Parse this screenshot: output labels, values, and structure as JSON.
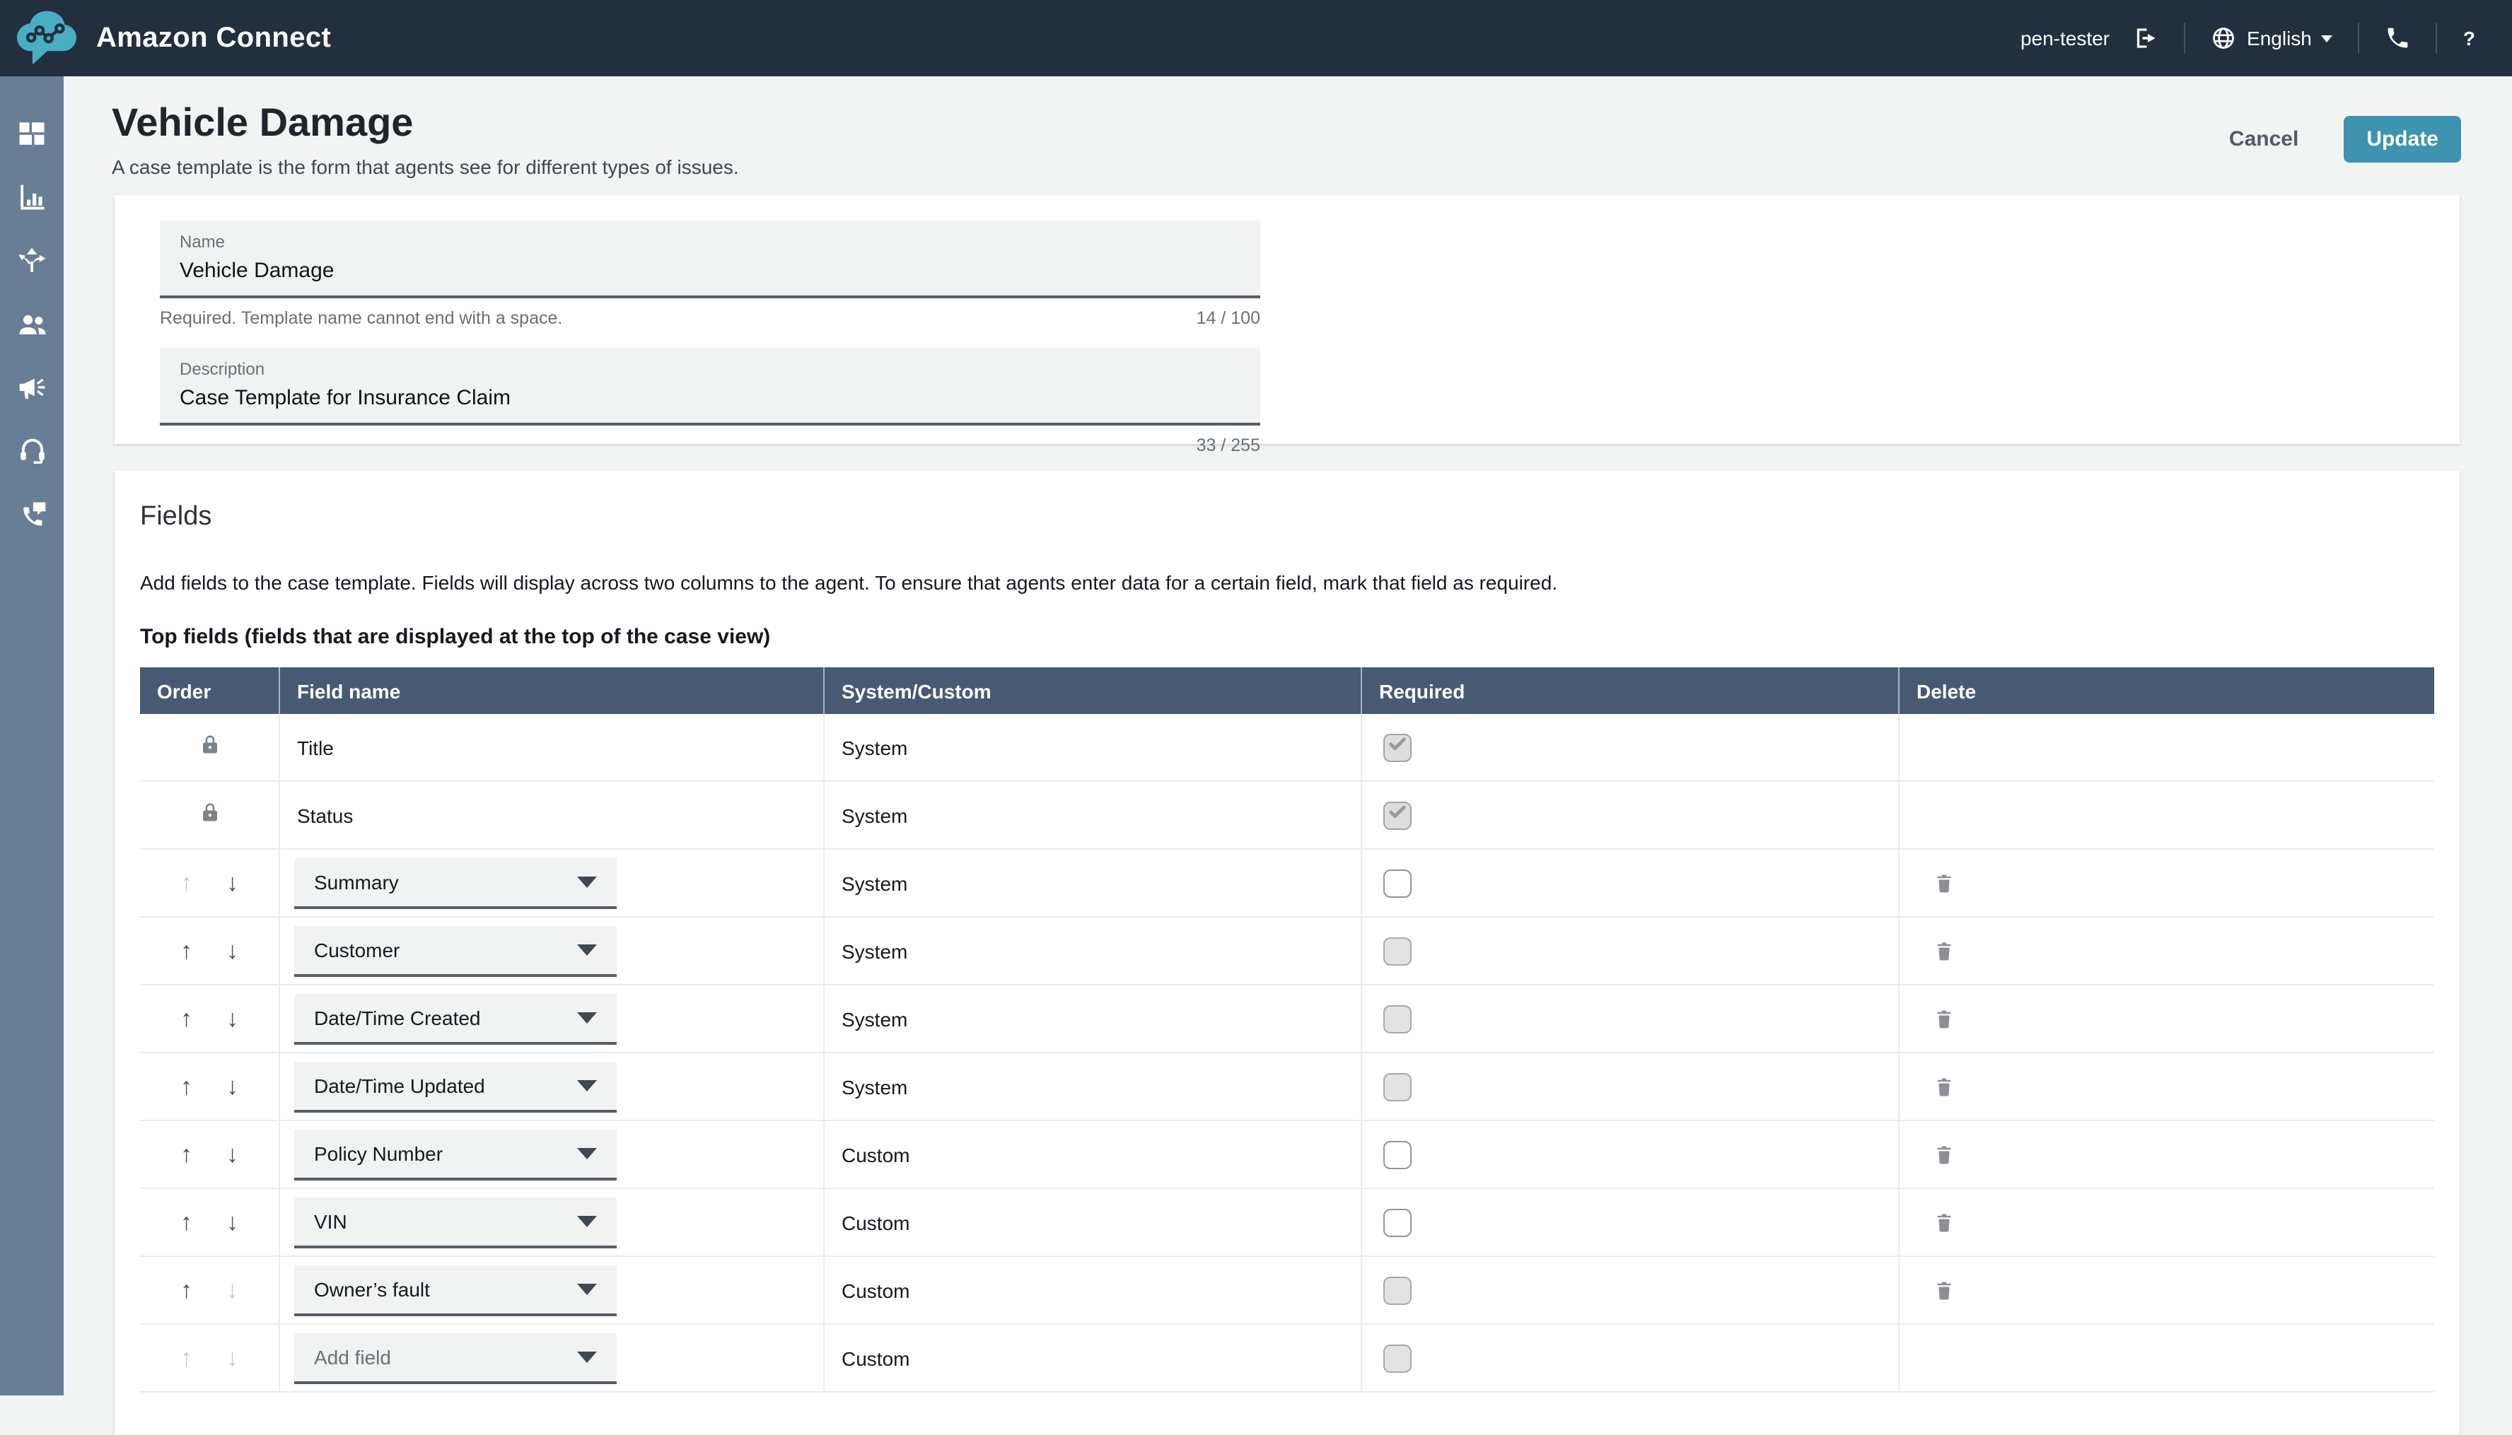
{
  "header": {
    "app_title": "Amazon Connect",
    "username": "pen-tester",
    "language": "English",
    "help_label": "?"
  },
  "sidebar": {
    "items": [
      {
        "icon": "dashboard-icon"
      },
      {
        "icon": "metrics-icon"
      },
      {
        "icon": "routing-icon"
      },
      {
        "icon": "users-icon"
      },
      {
        "icon": "megaphone-icon"
      },
      {
        "icon": "headset-icon"
      },
      {
        "icon": "contact-control-icon"
      }
    ]
  },
  "page": {
    "title": "Vehicle Damage",
    "subtitle": "A case template is the form that agents see for different types of issues.",
    "cancel_label": "Cancel",
    "update_label": "Update"
  },
  "form": {
    "name": {
      "label": "Name",
      "value": "Vehicle Damage",
      "helper": "Required. Template name cannot end with a space.",
      "counter": "14 / 100"
    },
    "description": {
      "label": "Description",
      "value": "Case Template for Insurance Claim",
      "counter": "33 / 255"
    }
  },
  "fields_section": {
    "heading": "Fields",
    "description": "Add fields to the case template. Fields will display across two columns to the agent. To ensure that agents enter data for a certain field, mark that field as required.",
    "top_fields_label": "Top fields (fields that are displayed at the top of the case view)",
    "table": {
      "columns": [
        "Order",
        "Field name",
        "System/Custom",
        "Required",
        "Delete"
      ],
      "rows": [
        {
          "field": "Title",
          "control": "static",
          "order": "locked",
          "system_custom": "System",
          "required": {
            "checked": true,
            "disabled": true
          },
          "deletable": false
        },
        {
          "field": "Status",
          "control": "static",
          "order": "locked",
          "system_custom": "System",
          "required": {
            "checked": true,
            "disabled": true
          },
          "deletable": false
        },
        {
          "field": "Summary",
          "control": "select",
          "order": {
            "up": false,
            "down": true
          },
          "system_custom": "System",
          "required": {
            "checked": false,
            "disabled": false
          },
          "deletable": true
        },
        {
          "field": "Customer",
          "control": "select",
          "order": {
            "up": true,
            "down": true
          },
          "system_custom": "System",
          "required": {
            "checked": false,
            "disabled": true
          },
          "deletable": true
        },
        {
          "field": "Date/Time Created",
          "control": "select",
          "order": {
            "up": true,
            "down": true
          },
          "system_custom": "System",
          "required": {
            "checked": false,
            "disabled": true
          },
          "deletable": true
        },
        {
          "field": "Date/Time Updated",
          "control": "select",
          "order": {
            "up": true,
            "down": true
          },
          "system_custom": "System",
          "required": {
            "checked": false,
            "disabled": true
          },
          "deletable": true
        },
        {
          "field": "Policy Number",
          "control": "select",
          "order": {
            "up": true,
            "down": true
          },
          "system_custom": "Custom",
          "required": {
            "checked": false,
            "disabled": false
          },
          "deletable": true
        },
        {
          "field": "VIN",
          "control": "select",
          "order": {
            "up": true,
            "down": true
          },
          "system_custom": "Custom",
          "required": {
            "checked": false,
            "disabled": false
          },
          "deletable": true
        },
        {
          "field": "Owner’s fault",
          "control": "select",
          "order": {
            "up": true,
            "down": false
          },
          "system_custom": "Custom",
          "required": {
            "checked": false,
            "disabled": true
          },
          "deletable": true
        },
        {
          "field": "Add field",
          "control": "select-placeholder",
          "order": {
            "up": false,
            "down": false
          },
          "system_custom": "Custom",
          "required": {
            "checked": false,
            "disabled": true
          },
          "deletable": false
        }
      ]
    }
  },
  "colors": {
    "header_bg": "#232f3e",
    "sidebar_bg": "#687e96",
    "table_header_bg": "#475a73",
    "update_button_bg": "#3d93b0",
    "logo_teal": "#4aaec2",
    "page_bg": "#f2f3f3"
  }
}
